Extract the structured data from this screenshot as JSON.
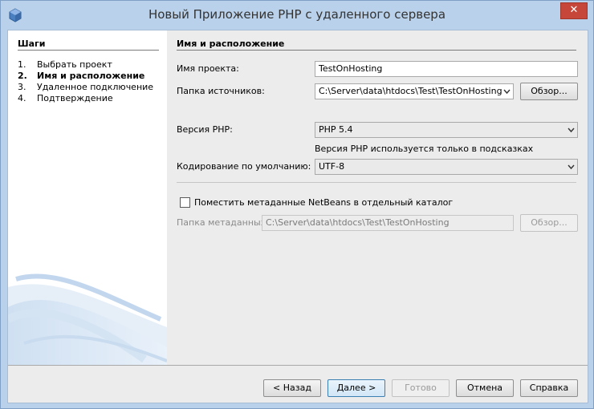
{
  "window": {
    "title": "Новый Приложение PHP с удаленного сервера",
    "close_glyph": "✕"
  },
  "steps": {
    "title": "Шаги",
    "items": [
      {
        "num": "1.",
        "label": "Выбрать проект"
      },
      {
        "num": "2.",
        "label": "Имя и расположение"
      },
      {
        "num": "3.",
        "label": "Удаленное подключение"
      },
      {
        "num": "4.",
        "label": "Подтверждение"
      }
    ],
    "current_index": 1
  },
  "content": {
    "title": "Имя и расположение",
    "project_name_label": "Имя проекта:",
    "project_name_value": "TestOnHosting",
    "sources_label": "Папка источников:",
    "sources_value": "C:\\Server\\data\\htdocs\\Test\\TestOnHosting",
    "browse_label": "Обзор...",
    "php_version_label": "Версия PHP:",
    "php_version_value": "PHP 5.4",
    "php_version_hint": "Версия PHP используется только в подсказках",
    "encoding_label": "Кодирование по умолчанию:",
    "encoding_value": "UTF-8",
    "metadata_checkbox_label": "Поместить метаданные NetBeans в отдельный каталог",
    "metadata_checked": false,
    "metadata_folder_label": "Папка метаданных:",
    "metadata_folder_value": "C:\\Server\\data\\htdocs\\Test\\TestOnHosting",
    "metadata_browse_label": "Обзор..."
  },
  "footer": {
    "back_label": "< Назад",
    "next_label": "Далее >",
    "finish_label": "Готово",
    "cancel_label": "Отмена",
    "help_label": "Справка"
  },
  "icons": {
    "app": "netbeans-cube-icon",
    "dropdown": "chevron-down-icon"
  }
}
